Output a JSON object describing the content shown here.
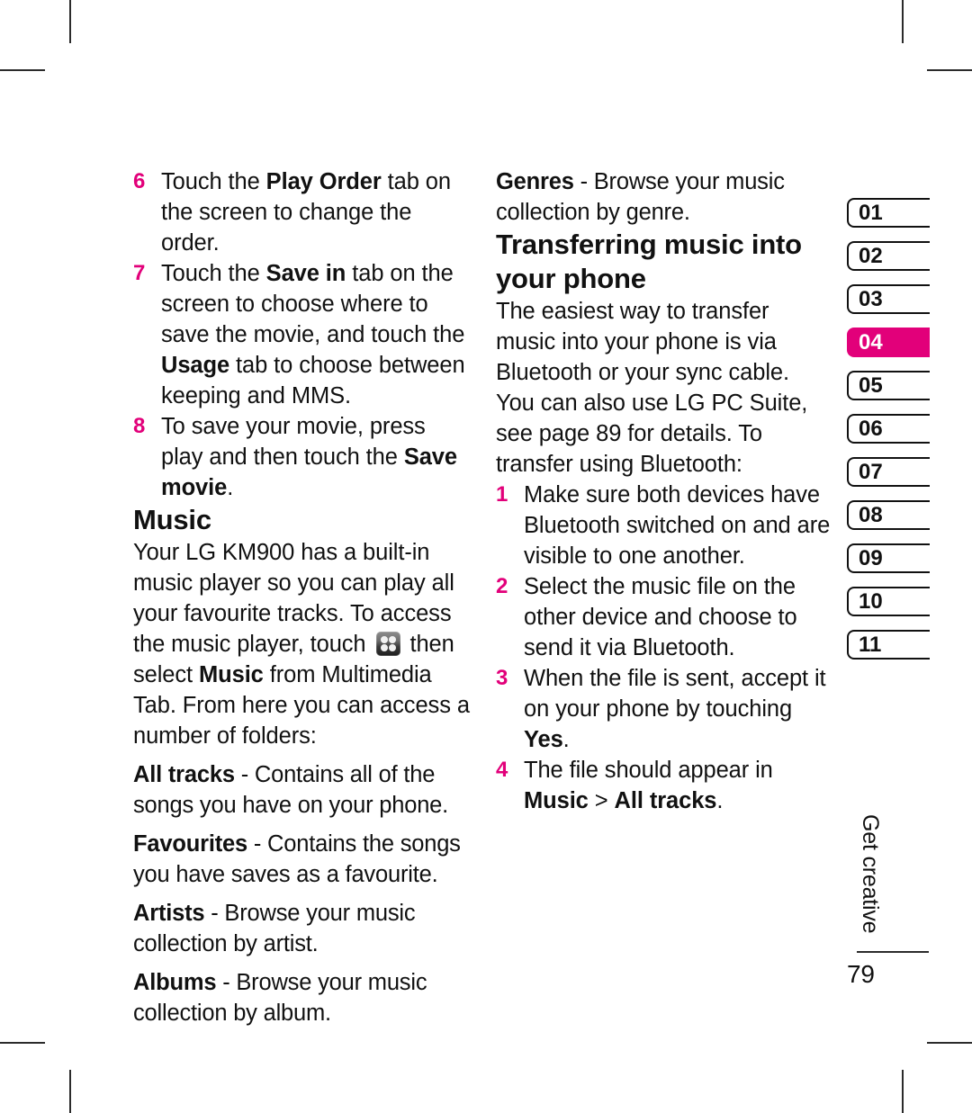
{
  "page": {
    "folio": "79",
    "running_head": "Get creative",
    "accent_color": "#E2007A"
  },
  "left_column": {
    "steps_continued": [
      {
        "num": "6",
        "parts": [
          {
            "t": "Touch the ",
            "b": false
          },
          {
            "t": "Play Order",
            "b": true
          },
          {
            "t": " tab on the screen to change the order.",
            "b": false
          }
        ]
      },
      {
        "num": "7",
        "parts": [
          {
            "t": "Touch the ",
            "b": false
          },
          {
            "t": "Save in",
            "b": true
          },
          {
            "t": " tab on the screen to choose where to save the movie, and touch the ",
            "b": false
          },
          {
            "t": "Usage",
            "b": true
          },
          {
            "t": " tab to choose between keeping and MMS.",
            "b": false
          }
        ]
      },
      {
        "num": "8",
        "parts": [
          {
            "t": "To save your movie, press play and then touch the ",
            "b": false
          },
          {
            "t": "Save movie",
            "b": true
          },
          {
            "t": ".",
            "b": false
          }
        ]
      }
    ],
    "heading": "Music",
    "intro_parts": [
      {
        "t": "Your LG KM900 has a built-in music player so you can play all your favourite tracks. To access the music player, touch ",
        "b": false
      },
      {
        "t": "ICON",
        "b": false,
        "icon": "multimedia-grid-icon"
      },
      {
        "t": " then select ",
        "b": false
      },
      {
        "t": "Music",
        "b": true
      },
      {
        "t": " from Multimedia Tab. From here you can access a number of folders:",
        "b": false
      }
    ],
    "folders": [
      {
        "term": "All tracks",
        "desc": " - Contains all of the songs you have on your phone."
      },
      {
        "term": "Favourites",
        "desc": " - Contains the songs you have saves as a favourite."
      },
      {
        "term": "Artists",
        "desc": " - Browse your music collection by artist."
      },
      {
        "term": "Albums",
        "desc": " - Browse your music collection by album."
      }
    ]
  },
  "right_column": {
    "folders_continued": [
      {
        "term": "Genres",
        "desc": " - Browse your music collection by genre."
      }
    ],
    "heading": "Transferring music into your phone",
    "paragraphs": [
      "The easiest way to transfer music into your phone is via Bluetooth or your sync cable.",
      "You can also use LG PC Suite, see page 89 for details. To transfer using Bluetooth:"
    ],
    "steps": [
      {
        "num": "1",
        "parts": [
          {
            "t": "Make sure both devices have Bluetooth switched on and are visible to one another.",
            "b": false
          }
        ]
      },
      {
        "num": "2",
        "parts": [
          {
            "t": "Select the music file on the other device and choose to send it via Bluetooth.",
            "b": false
          }
        ]
      },
      {
        "num": "3",
        "parts": [
          {
            "t": "When the file is sent, accept it on your phone by touching ",
            "b": false
          },
          {
            "t": "Yes",
            "b": true
          },
          {
            "t": ".",
            "b": false
          }
        ]
      },
      {
        "num": "4",
        "parts": [
          {
            "t": "The file should appear in ",
            "b": false
          },
          {
            "t": "Music",
            "b": true
          },
          {
            "t": " > ",
            "b": false
          },
          {
            "t": "All tracks",
            "b": true
          },
          {
            "t": ".",
            "b": false
          }
        ]
      }
    ]
  },
  "chapter_tabs": [
    {
      "label": "01",
      "active": false
    },
    {
      "label": "02",
      "active": false
    },
    {
      "label": "03",
      "active": false
    },
    {
      "label": "04",
      "active": true
    },
    {
      "label": "05",
      "active": false
    },
    {
      "label": "06",
      "active": false
    },
    {
      "label": "07",
      "active": false
    },
    {
      "label": "08",
      "active": false
    },
    {
      "label": "09",
      "active": false
    },
    {
      "label": "10",
      "active": false
    },
    {
      "label": "11",
      "active": false
    }
  ]
}
